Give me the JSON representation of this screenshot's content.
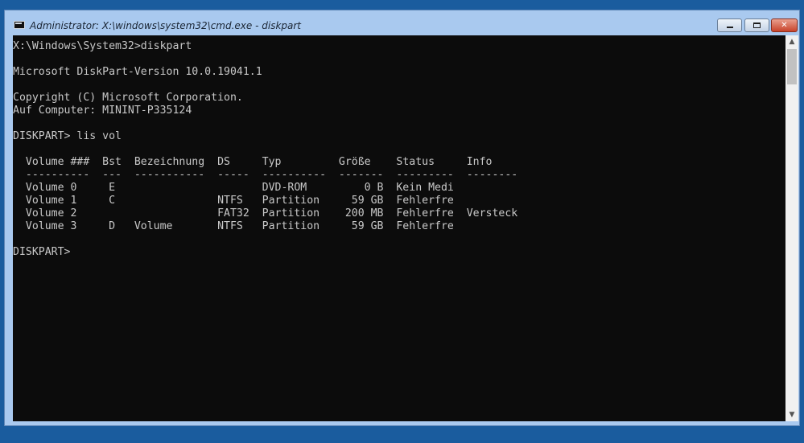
{
  "window": {
    "title": "Administrator: X:\\windows\\system32\\cmd.exe - diskpart",
    "app_icon": "cmd-console-icon",
    "controls": {
      "minimize": "minimize-icon",
      "maximize": "maximize-icon",
      "close": "close-icon",
      "close_glyph": "✕"
    }
  },
  "console": {
    "lines": [
      "X:\\Windows\\System32>diskpart",
      "",
      "Microsoft DiskPart-Version 10.0.19041.1",
      "",
      "Copyright (C) Microsoft Corporation.",
      "Auf Computer: MININT-P335124",
      "",
      "DISKPART> lis vol",
      "",
      "  Volume ###  Bst  Bezeichnung  DS     Typ         Größe    Status     Info",
      "  ----------  ---  -----------  -----  ----------  -------  ---------  --------",
      "  Volume 0     E                       DVD-ROM         0 B  Kein Medi",
      "  Volume 1     C                NTFS   Partition     59 GB  Fehlerfre",
      "  Volume 2                      FAT32  Partition    200 MB  Fehlerfre  Versteck",
      "  Volume 3     D   Volume       NTFS   Partition     59 GB  Fehlerfre",
      "",
      "DISKPART>"
    ]
  },
  "scrollbar": {
    "up": "chevron-up-icon",
    "down": "chevron-down-icon",
    "up_glyph": "▲",
    "down_glyph": "▼"
  },
  "colors": {
    "background": "#0c0c0c",
    "text": "#c8c8c8",
    "frame": "#a9c9ef",
    "desktop": "#1a5c9e"
  }
}
